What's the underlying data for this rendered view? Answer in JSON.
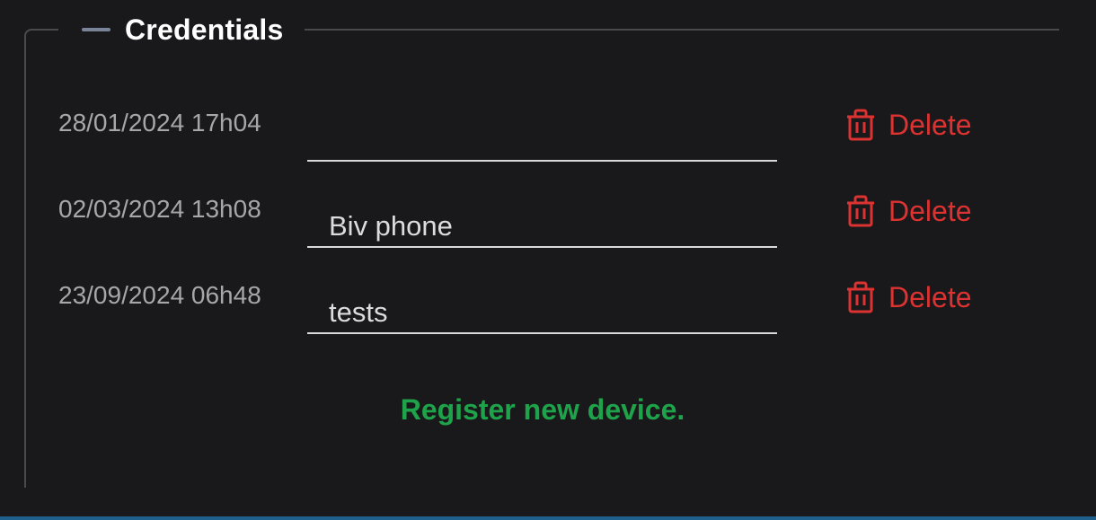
{
  "section": {
    "title": "Credentials",
    "collapse_icon": "minus-icon"
  },
  "credentials": [
    {
      "date": "28/01/2024 17h04",
      "name": "",
      "delete_label": "Delete"
    },
    {
      "date": "02/03/2024 13h08",
      "name": "Biv phone",
      "delete_label": "Delete"
    },
    {
      "date": "23/09/2024 06h48",
      "name": "tests",
      "delete_label": "Delete"
    }
  ],
  "register_label": "Register new device.",
  "colors": {
    "background": "#19191b",
    "delete": "#dc3232",
    "register": "#1ea34a",
    "accent_bar": "#1f5f8b"
  }
}
